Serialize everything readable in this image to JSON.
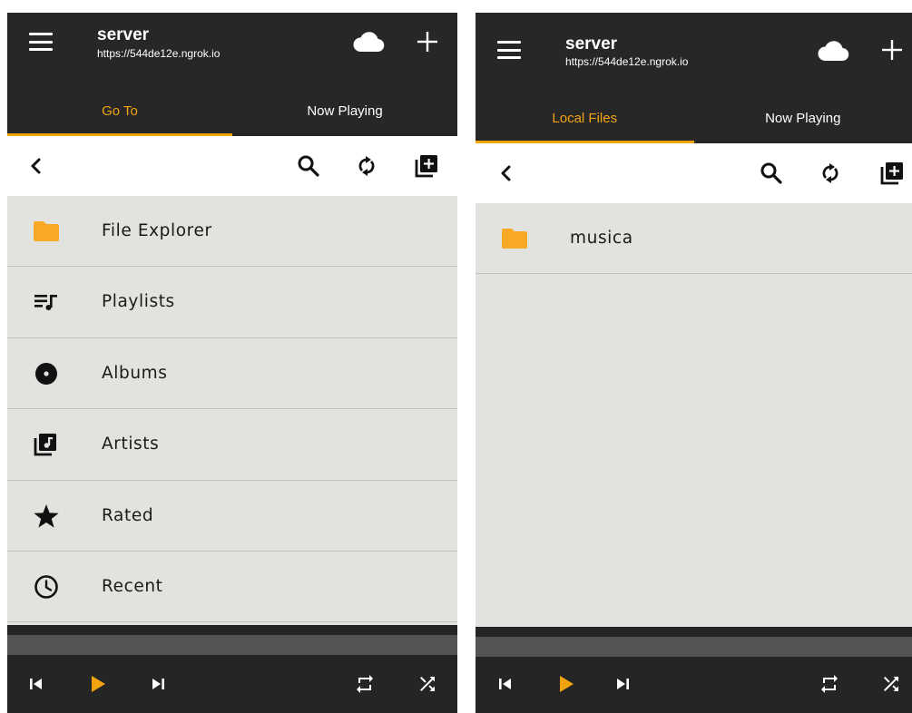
{
  "colors": {
    "accent": "#f2a40f",
    "appbar": "#272727",
    "list_bg": "#e2e2df",
    "player_bg": "#252525"
  },
  "screens": [
    {
      "server_name": "server",
      "server_url": "https://544de12e.ngrok.io",
      "tabs": [
        {
          "label": "Go To",
          "active": true
        },
        {
          "label": "Now Playing",
          "active": false
        }
      ],
      "toolbar": {
        "icons": [
          "back-icon",
          "search-icon",
          "refresh-icon",
          "add-to-library-icon"
        ]
      },
      "items": [
        {
          "label": "File Explorer",
          "icon": "folder-icon"
        },
        {
          "label": "Playlists",
          "icon": "playlist-icon"
        },
        {
          "label": "Albums",
          "icon": "album-icon"
        },
        {
          "label": "Artists",
          "icon": "artist-icon"
        },
        {
          "label": "Rated",
          "icon": "star-icon"
        },
        {
          "label": "Recent",
          "icon": "clock-icon"
        }
      ],
      "player": {
        "icons": [
          "skip-previous-icon",
          "play-icon",
          "skip-next-icon",
          "repeat-icon",
          "shuffle-icon"
        ]
      }
    },
    {
      "server_name": "server",
      "server_url": "https://544de12e.ngrok.io",
      "tabs": [
        {
          "label": "Local Files",
          "active": true
        },
        {
          "label": "Now Playing",
          "active": false
        }
      ],
      "toolbar": {
        "icons": [
          "back-icon",
          "search-icon",
          "refresh-icon",
          "add-to-library-icon"
        ]
      },
      "items": [
        {
          "label": "musica",
          "icon": "folder-icon"
        }
      ],
      "player": {
        "icons": [
          "skip-previous-icon",
          "play-icon",
          "skip-next-icon",
          "repeat-icon",
          "shuffle-icon"
        ]
      }
    }
  ]
}
